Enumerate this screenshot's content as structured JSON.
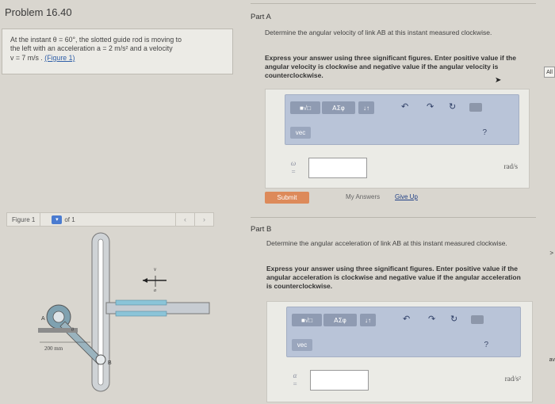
{
  "problem": {
    "title": "Problem 16.40",
    "statement_line1": "At the instant θ = 60°, the slotted guide rod is moving to",
    "statement_line2": "the left with an acceleration a = 2  m/s² and a velocity",
    "statement_line3": "v = 7  m/s .",
    "figure_link": "(Figure 1)"
  },
  "figure_nav": {
    "label": "Figure 1",
    "of_text": "of 1",
    "prev_icon": "chevron-left",
    "next_icon": "chevron-right"
  },
  "figure": {
    "label_A": "A",
    "label_B": "B",
    "label_theta": "θ",
    "label_v": "v",
    "label_a": "a",
    "dimension": "200 mm"
  },
  "part_a": {
    "title": "Part A",
    "question": "Determine the angular velocity of link AB at this instant measured clockwise.",
    "instruction": "Express your answer using three significant figures. Enter positive value if the angular velocity is clockwise and negative value if the angular velocity is counterclockwise.",
    "variable": "ω =",
    "unit": "rad/s",
    "submit_label": "Submit",
    "my_answers_label": "My Answers",
    "give_up_label": "Give Up"
  },
  "part_b": {
    "title": "Part B",
    "question": "Determine the angular acceleration of link AB at this instant measured clockwise.",
    "instruction": "Express your answer using three significant figures. Enter positive value if the angular acceleration is clockwise and negative value if the angular acceleration is counterclockwise.",
    "variable": "α =",
    "unit": "rad/s²"
  },
  "toolbar": {
    "sqrt_label": "■√□",
    "greek_label": "ΑΣφ",
    "arrows_label": "↓↑",
    "undo_icon": "undo-arrow",
    "redo_icon": "redo-arrow",
    "reset_icon": "reset-circle",
    "keyboard_icon": "keyboard",
    "vec_label": "vec",
    "help_label": "?"
  },
  "edge": {
    "tab_label": "All",
    "frag1": ">",
    "frag2": "av"
  },
  "colors": {
    "toolbar_bg": "#b9c4d8",
    "submit_bg": "#dd8a5a",
    "link": "#2f5fa8"
  }
}
